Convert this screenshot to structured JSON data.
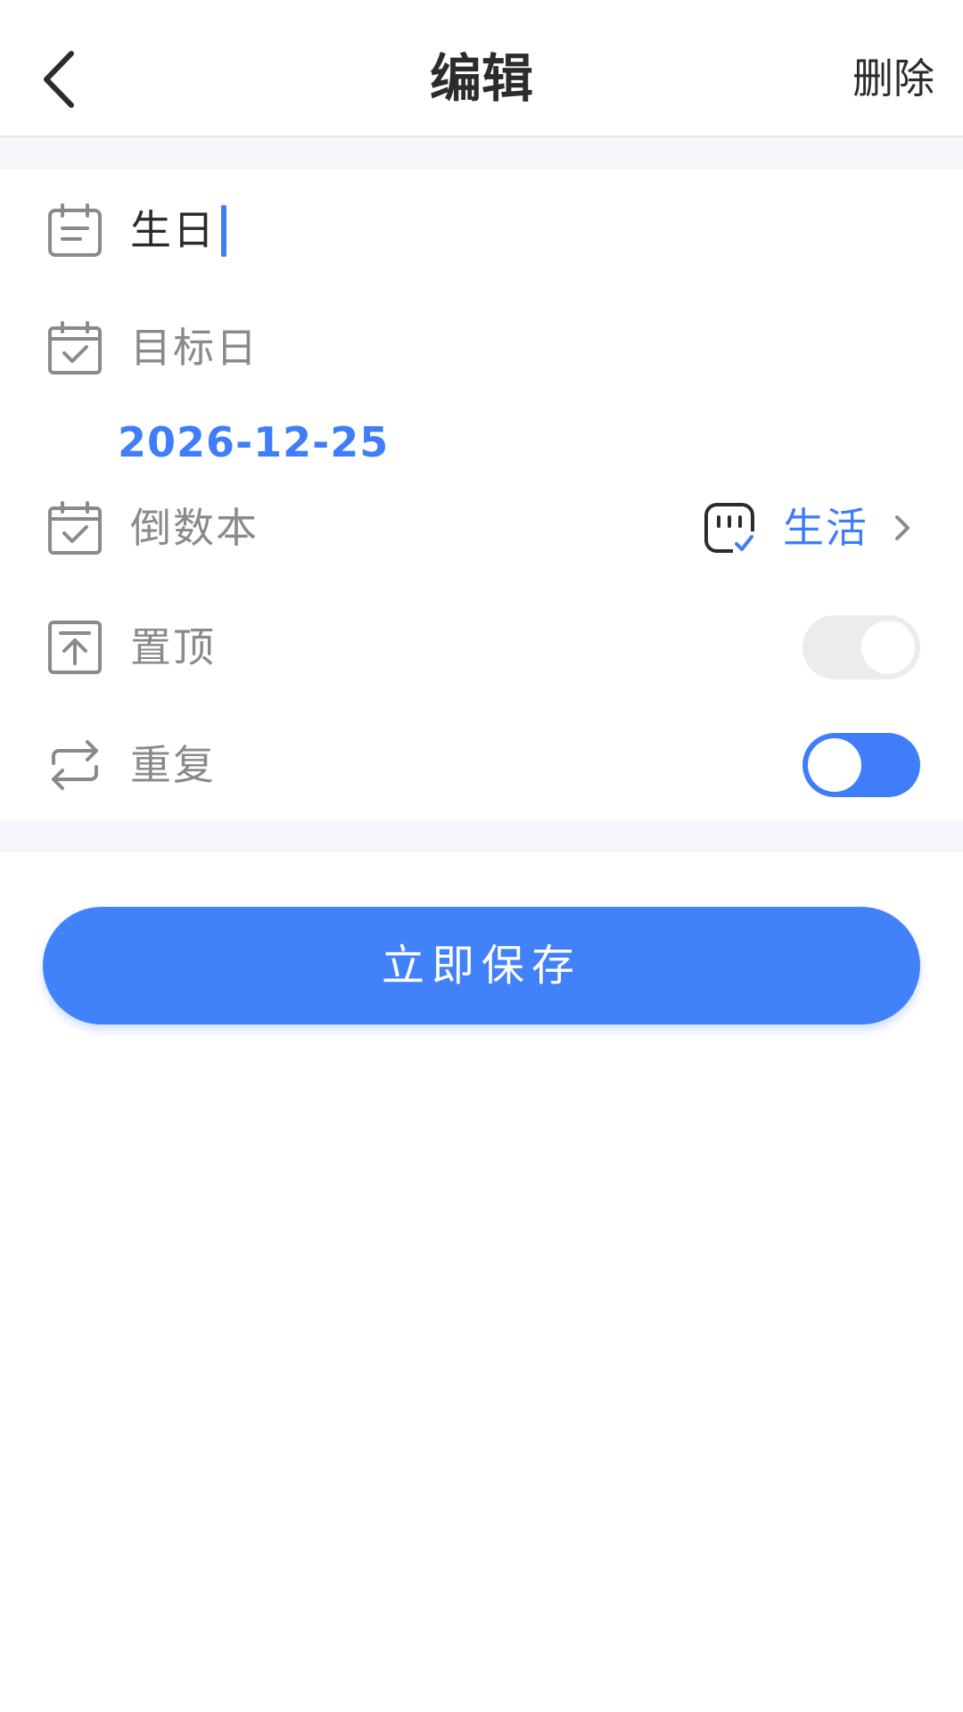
{
  "header": {
    "title": "编辑",
    "delete_label": "删除"
  },
  "form": {
    "name_value": "生日",
    "target_day_label": "目标日",
    "target_date": "2026-12-25",
    "notebook_label": "倒数本",
    "notebook_value": "生活",
    "pin_label": "置顶",
    "pin_enabled": false,
    "repeat_label": "重复",
    "repeat_enabled": true
  },
  "actions": {
    "save_label": "立即保存"
  },
  "colors": {
    "accent": "#3f7ef8",
    "icon_gray": "#8a8a8e",
    "section_gap": "#f4f6fa"
  },
  "icons": {
    "back": "chevron-left-icon",
    "name": "calendar-lines-icon",
    "target": "calendar-check-icon",
    "notebook": "calendar-check-icon",
    "category": "notebook-icon",
    "pin": "pin-top-icon",
    "repeat": "repeat-icon"
  }
}
